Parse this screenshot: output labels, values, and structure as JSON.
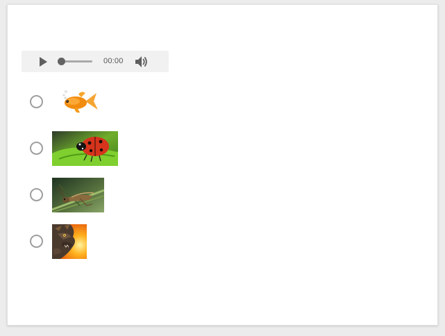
{
  "audio": {
    "time": "00:00",
    "progress": 0
  },
  "options": [
    {
      "icon": "goldfish-image"
    },
    {
      "icon": "ladybug-image"
    },
    {
      "icon": "grasshopper-image"
    },
    {
      "icon": "dragon-image"
    }
  ]
}
